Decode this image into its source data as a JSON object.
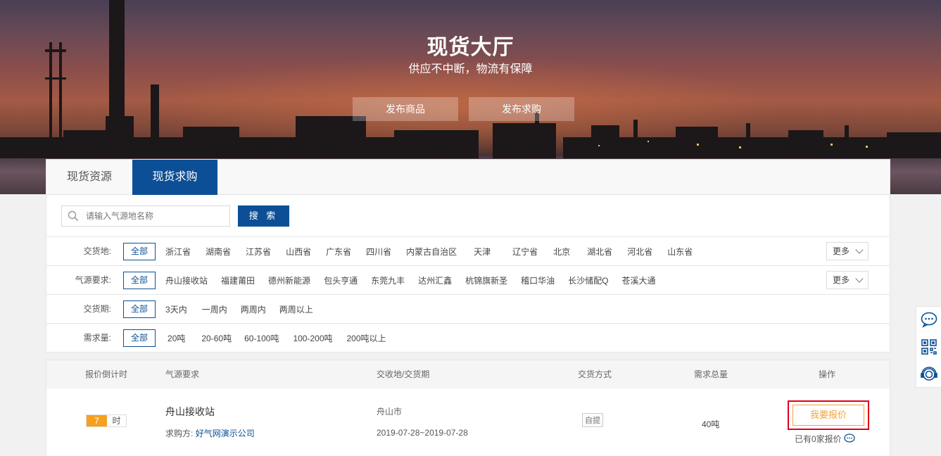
{
  "hero": {
    "title": "现货大厅",
    "subtitle": "供应不中断，物流有保障",
    "btn_publish_goods": "发布商品",
    "btn_publish_demand": "发布求购"
  },
  "tabs": [
    {
      "label": "现货资源",
      "active": false
    },
    {
      "label": "现货求购",
      "active": true
    }
  ],
  "search": {
    "placeholder": "请输入气源地名称",
    "button": "搜 索"
  },
  "filters": {
    "location": {
      "label": "交货地:",
      "items": [
        "全部",
        "浙江省",
        "湖南省",
        "江苏省",
        "山西省",
        "广东省",
        "四川省",
        "内蒙古自治区",
        "天津",
        "辽宁省",
        "北京",
        "湖北省",
        "河北省",
        "山东省"
      ],
      "more": "更多"
    },
    "source": {
      "label": "气源要求:",
      "items": [
        "全部",
        "舟山接收站",
        "福建莆田",
        "德州新能源",
        "包头亨通",
        "东莞九丰",
        "达州汇鑫",
        "杭锦旗新圣",
        "稽口华油",
        "长沙储配Q",
        "苍溪大通"
      ],
      "more": "更多"
    },
    "period": {
      "label": "交货期:",
      "items": [
        "全部",
        "3天内",
        "一周内",
        "两周内",
        "两周以上"
      ]
    },
    "quantity": {
      "label": "需求量:",
      "items": [
        "全部",
        "20吨",
        "20-60吨",
        "60-100吨",
        "100-200吨",
        "200吨以上"
      ]
    }
  },
  "list": {
    "headers": {
      "countdown": "报价倒计时",
      "source": "气源要求",
      "place_date": "交收地/交货期",
      "delivery": "交货方式",
      "total": "需求总量",
      "action": "操作"
    },
    "rows": [
      {
        "countdown_value": "7",
        "countdown_unit": "时",
        "source": "舟山接收站",
        "buyer_label": "求购方:",
        "buyer": "好气网演示公司",
        "city": "舟山市",
        "date_range": "2019-07-28~2019-07-28",
        "delivery": "自提",
        "quantity": "40吨",
        "quote_button": "我要报价",
        "quoted_text": "已有0家报价"
      }
    ]
  },
  "colors": {
    "primary": "#0c4f96",
    "accent": "#f6a020",
    "quote": "#f0a43a",
    "highlight": "#e0001b"
  }
}
